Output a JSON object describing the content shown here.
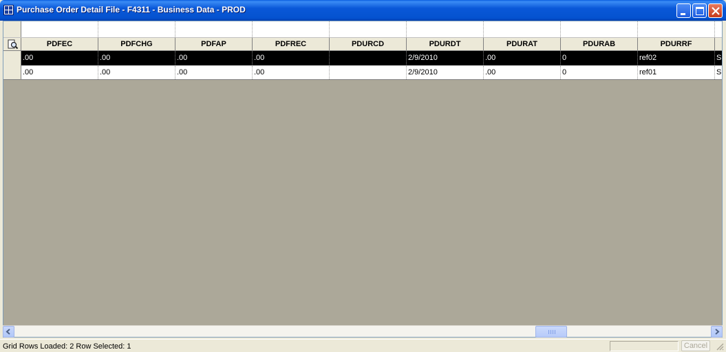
{
  "window": {
    "title": "Purchase Order Detail File - F4311 - Business Data - PROD",
    "icon": "grid-app-icon"
  },
  "title_buttons": [
    "minimize",
    "maximize",
    "close"
  ],
  "grid": {
    "columns": [
      "PDFEC",
      "PDFCHG",
      "PDFAP",
      "PDFREC",
      "PDURCD",
      "PDURDT",
      "PDURAT",
      "PDURAB",
      "PDURRF",
      ""
    ],
    "rows": [
      {
        "selected": true,
        "cells": [
          ".00",
          ".00",
          ".00",
          ".00",
          "",
          "2/9/2010",
          ".00",
          "0",
          "ref02",
          "S"
        ]
      },
      {
        "selected": false,
        "cells": [
          ".00",
          ".00",
          ".00",
          ".00",
          "",
          "2/9/2010",
          ".00",
          "0",
          "ref01",
          "S"
        ]
      }
    ]
  },
  "status": {
    "text": "Grid Rows Loaded:  2     Row Selected:  1",
    "cancel_label": "Cancel"
  },
  "colors": {
    "title_bar": "#0452cf",
    "grid_background": "#aca899",
    "selected_row": "#000000"
  }
}
